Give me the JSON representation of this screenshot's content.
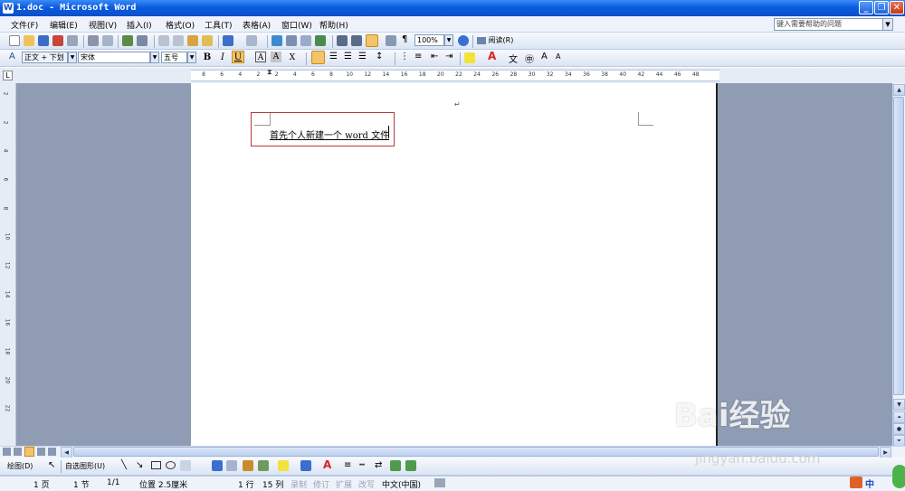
{
  "window": {
    "title": "1.doc - Microsoft Word"
  },
  "menu": {
    "items": [
      "文件(F)",
      "编辑(E)",
      "视图(V)",
      "插入(I)",
      "格式(O)",
      "工具(T)",
      "表格(A)",
      "窗口(W)",
      "帮助(H)"
    ],
    "help_placeholder": "键入需要帮助的问题"
  },
  "standard_toolbar": {
    "zoom": "100%",
    "read_label": "阅读(R)"
  },
  "format_toolbar": {
    "style": "正文 + 下划",
    "font": "宋体",
    "size": "五号",
    "bold": "B",
    "italic": "I",
    "underline": "U"
  },
  "ruler": {
    "h_ticks": [
      "8",
      "6",
      "4",
      "2",
      "2",
      "4",
      "6",
      "8",
      "10",
      "12",
      "14",
      "16",
      "18",
      "20",
      "22",
      "24",
      "26",
      "28",
      "30",
      "32",
      "34",
      "36",
      "38",
      "40",
      "42",
      "44",
      "46",
      "48"
    ],
    "v_ticks": [
      "2",
      "2",
      "4",
      "6",
      "8",
      "10",
      "12",
      "14",
      "16",
      "18",
      "20",
      "22"
    ]
  },
  "document": {
    "text": "首先个人新建一个 word 文件",
    "paragraph_mark": "↵"
  },
  "drawing_toolbar": {
    "draw_label": "绘图(D)",
    "autoshape_label": "自选图形(U)"
  },
  "status_bar": {
    "page": "1 页",
    "section": "1 节",
    "page_of": "1/1",
    "position": "位置 2.5厘米",
    "line": "1 行",
    "column": "15 列",
    "rec": "录制",
    "trk": "修订",
    "ext": "扩展",
    "ovr": "改写",
    "language": "中文(中国)"
  },
  "watermark": {
    "brand": "Bai经验",
    "url": "jingyan.baidu.com"
  },
  "colors": {
    "titlebar": "#0b5ce0",
    "doc_background": "#8f9cb3",
    "highlight": "#b53a3a"
  }
}
